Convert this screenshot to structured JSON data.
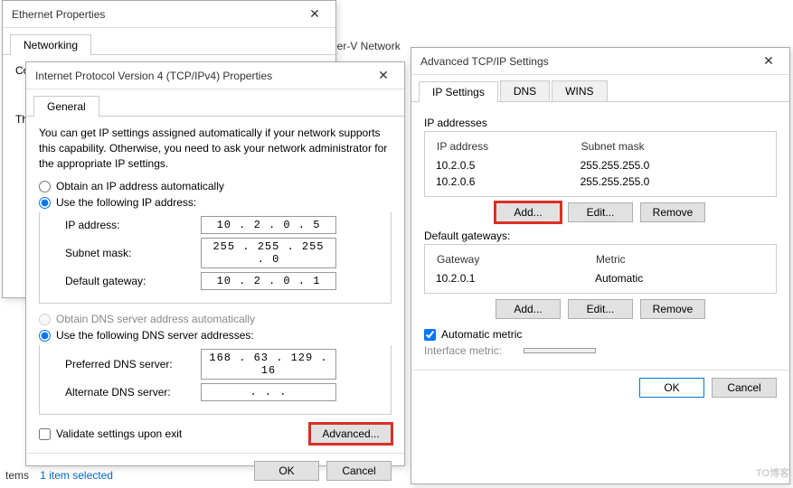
{
  "bg_network": "yper-V Network",
  "ethernet": {
    "title": "Ethernet Properties",
    "tab": "Networking",
    "connect_using": "Con",
    "th": "Th"
  },
  "ipv4": {
    "title": "Internet Protocol Version 4 (TCP/IPv4) Properties",
    "tab": "General",
    "description": "You can get IP settings assigned automatically if your network supports this capability. Otherwise, you need to ask your network administrator for the appropriate IP settings.",
    "radio_auto_ip": "Obtain an IP address automatically",
    "radio_use_ip": "Use the following IP address:",
    "lbl_ip": "IP address:",
    "lbl_subnet": "Subnet mask:",
    "lbl_gateway": "Default gateway:",
    "val_ip": "10 .  2 .  0 .  5",
    "val_subnet": "255 . 255 . 255 .  0",
    "val_gateway": "10 .  2 .  0 .  1",
    "radio_auto_dns": "Obtain DNS server address automatically",
    "radio_use_dns": "Use the following DNS server addresses:",
    "lbl_pref_dns": "Preferred DNS server:",
    "lbl_alt_dns": "Alternate DNS server:",
    "val_pref_dns": "168 . 63 . 129 . 16",
    "val_alt_dns": " .     .     . ",
    "chk_validate": "Validate settings upon exit",
    "btn_advanced": "Advanced...",
    "btn_ok": "OK",
    "btn_cancel": "Cancel"
  },
  "adv": {
    "title": "Advanced TCP/IP Settings",
    "tabs": {
      "ip": "IP Settings",
      "dns": "DNS",
      "wins": "WINS"
    },
    "ip_addresses_label": "IP addresses",
    "ip_header_addr": "IP address",
    "ip_header_mask": "Subnet mask",
    "ip_rows": [
      {
        "addr": "10.2.0.5",
        "mask": "255.255.255.0"
      },
      {
        "addr": "10.2.0.6",
        "mask": "255.255.255.0"
      }
    ],
    "gateways_label": "Default gateways:",
    "gw_header_gw": "Gateway",
    "gw_header_metric": "Metric",
    "gw_rows": [
      {
        "gw": "10.2.0.1",
        "metric": "Automatic"
      }
    ],
    "btn_add": "Add...",
    "btn_edit": "Edit...",
    "btn_remove": "Remove",
    "chk_auto_metric": "Automatic metric",
    "lbl_if_metric": "Interface metric:",
    "btn_ok": "OK",
    "btn_cancel": "Cancel"
  },
  "status_bar": {
    "items": "tems",
    "selected": "1 item selected"
  },
  "watermark": "TO博客"
}
